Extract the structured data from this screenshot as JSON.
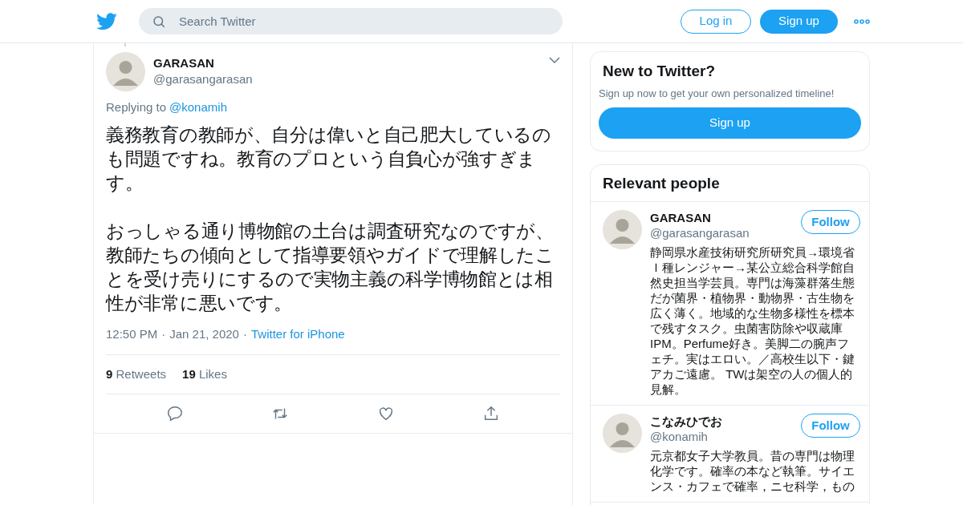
{
  "header": {
    "search": {
      "placeholder": "Search Twitter"
    },
    "buttons": [
      {
        "label": "Log in",
        "kind": "outline"
      },
      {
        "label": "Sign up",
        "kind": "filled"
      }
    ]
  },
  "tweet": {
    "name": "GARASAN",
    "handle": "@garasangarasan",
    "replying_label": "Replying to",
    "replying_to": "@konamih",
    "paragraphs": [
      "義務教育の教師が、自分は偉いと自己肥大しているのも問題ですね。教育のプロという自負心が強すぎます。",
      "おっしゃる通り博物館の土台は調査研究なのですが、教師たちの傾向として指導要領やガイドで理解したことを受け売りにするので実物主義の科学博物館とは相性が非常に悪いです。"
    ],
    "time": "12:50 PM",
    "separator": "·",
    "date": "Jan 21, 2020",
    "source": "Twitter for iPhone",
    "stats": [
      {
        "count": "9",
        "label": "Retweets"
      },
      {
        "count": "19",
        "label": "Likes"
      }
    ]
  },
  "signup_card": {
    "title": "New to Twitter?",
    "text": "Sign up now to get your own personalized timeline!",
    "button": "Sign up"
  },
  "relevant_people": {
    "title": "Relevant people",
    "people": [
      {
        "name": "GARASAN",
        "handle": "@garasangarasan",
        "button": "Follow",
        "bio": "静岡県水産技術研究所研究員→環境省Ｉ種レンジャー→某公立総合科学館自然史担当学芸員。専門は海藻群落生態だが菌界・植物界・動物界・古生物を広く薄く。地域的な生物多様性を標本で残すタスク。虫菌害防除や収蔵庫IPM。Perfume好き。美脚二の腕声フェチ。実はエロい。／高校生以下・鍵アカご遠慮。 TWは架空の人の個人的見解。"
      },
      {
        "name": "こなみひでお",
        "handle": "@konamih",
        "button": "Follow",
        "bio": "元京都女子大学教員。昔の専門は物理化学です。確率の本など執筆。サイエンス・カフェで確率，ニセ科学，もの"
      }
    ]
  }
}
